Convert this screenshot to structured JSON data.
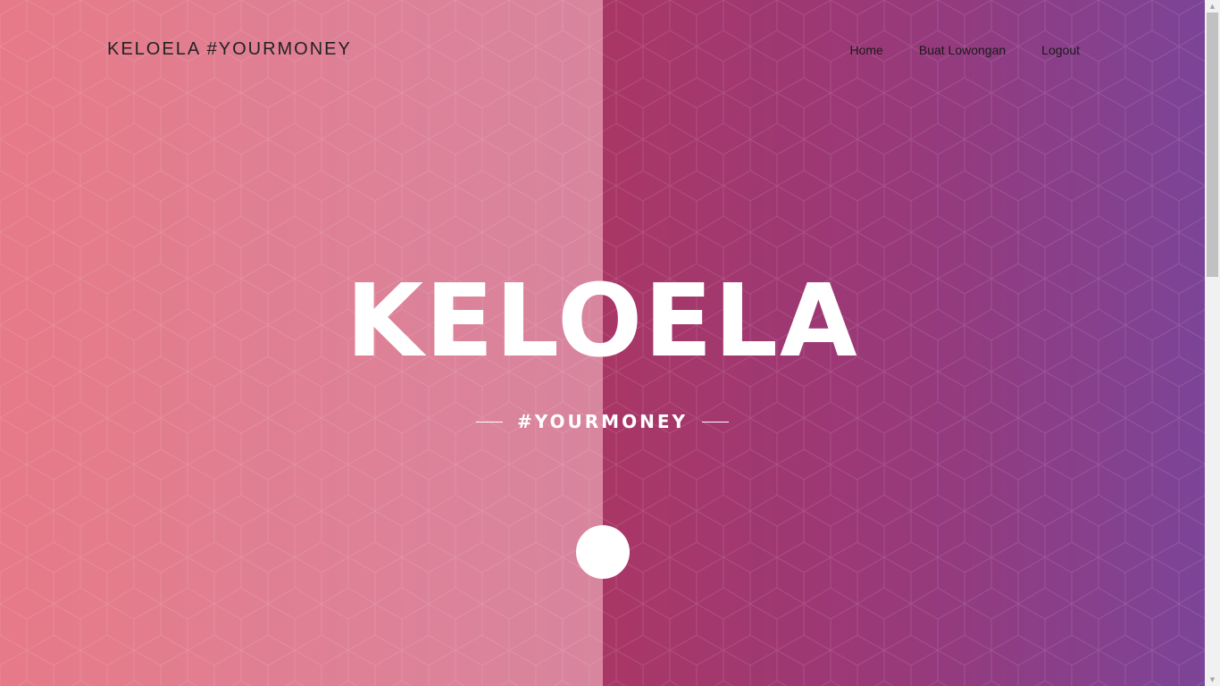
{
  "navbar": {
    "brand": "KELOELA #YOURMONEY",
    "links": [
      "Home",
      "Buat Lowongan",
      "Logout"
    ]
  },
  "hero": {
    "title": "KELOELA",
    "subtitle": "#YOURMONEY"
  },
  "colors": {
    "left_panel": "#e07f93",
    "right_panel": "#98397a",
    "text_light": "#ffffff",
    "text_dark": "#1a1a1a"
  },
  "icons": {
    "scroll_down": "circle-button",
    "scroll_up_arrow": "triangle-up",
    "scroll_down_arrow": "triangle-down"
  },
  "scrollbar": {
    "up_glyph": "▲",
    "down_glyph": "▼"
  }
}
